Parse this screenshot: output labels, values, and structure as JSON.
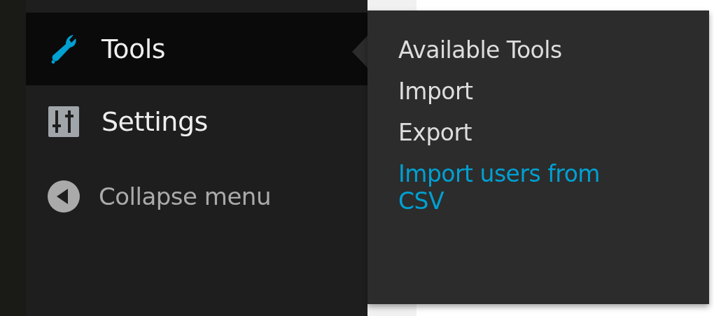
{
  "sidebar": {
    "items": [
      {
        "label": "Tools",
        "kind": "wrench",
        "selected": true
      },
      {
        "label": "Settings",
        "kind": "sliders",
        "selected": false
      }
    ],
    "collapse": {
      "label": "Collapse menu"
    }
  },
  "submenu": {
    "items": [
      {
        "label": "Available Tools",
        "selected": false
      },
      {
        "label": "Import",
        "selected": false
      },
      {
        "label": "Export",
        "selected": false
      },
      {
        "label": "Import users from CSV",
        "selected": true
      }
    ]
  }
}
